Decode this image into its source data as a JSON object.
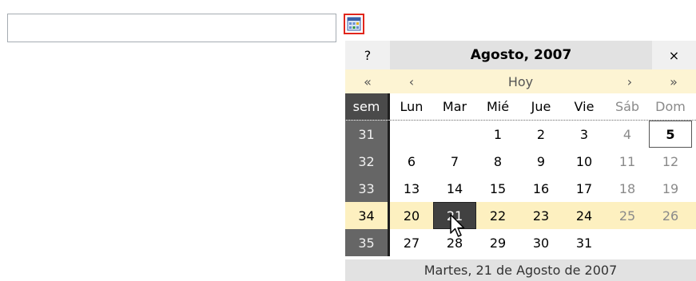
{
  "date_input": {
    "value": "",
    "placeholder": ""
  },
  "trigger": {
    "icon": "calendar-icon"
  },
  "calendar": {
    "help_label": "?",
    "title": "Agosto, 2007",
    "close_label": "×",
    "nav": {
      "prev_year": "«",
      "prev_month": "‹",
      "today": "Hoy",
      "next_month": "›",
      "next_year": "»"
    },
    "week_header": "sem",
    "day_names": [
      "Lun",
      "Mar",
      "Mié",
      "Jue",
      "Vie",
      "Sáb",
      "Dom"
    ],
    "weeks": [
      {
        "num": "31",
        "days": [
          "",
          "",
          "1",
          "2",
          "3",
          "4",
          "5"
        ]
      },
      {
        "num": "32",
        "days": [
          "6",
          "7",
          "8",
          "9",
          "10",
          "11",
          "12"
        ]
      },
      {
        "num": "33",
        "days": [
          "13",
          "14",
          "15",
          "16",
          "17",
          "18",
          "19"
        ]
      },
      {
        "num": "34",
        "days": [
          "20",
          "21",
          "22",
          "23",
          "24",
          "25",
          "26"
        ]
      },
      {
        "num": "35",
        "days": [
          "27",
          "28",
          "29",
          "30",
          "31",
          "",
          ""
        ]
      }
    ],
    "today_date": "5",
    "selected_date": "21",
    "highlight_week": "34",
    "footer": "Martes, 21 de Agosto de 2007"
  },
  "colors": {
    "nav_bg": "#fdf4d3",
    "highlight_row": "#fdf0c0",
    "selected_bg": "#414141",
    "week_col_bg": "#666666",
    "trigger_border": "#e1261c"
  }
}
